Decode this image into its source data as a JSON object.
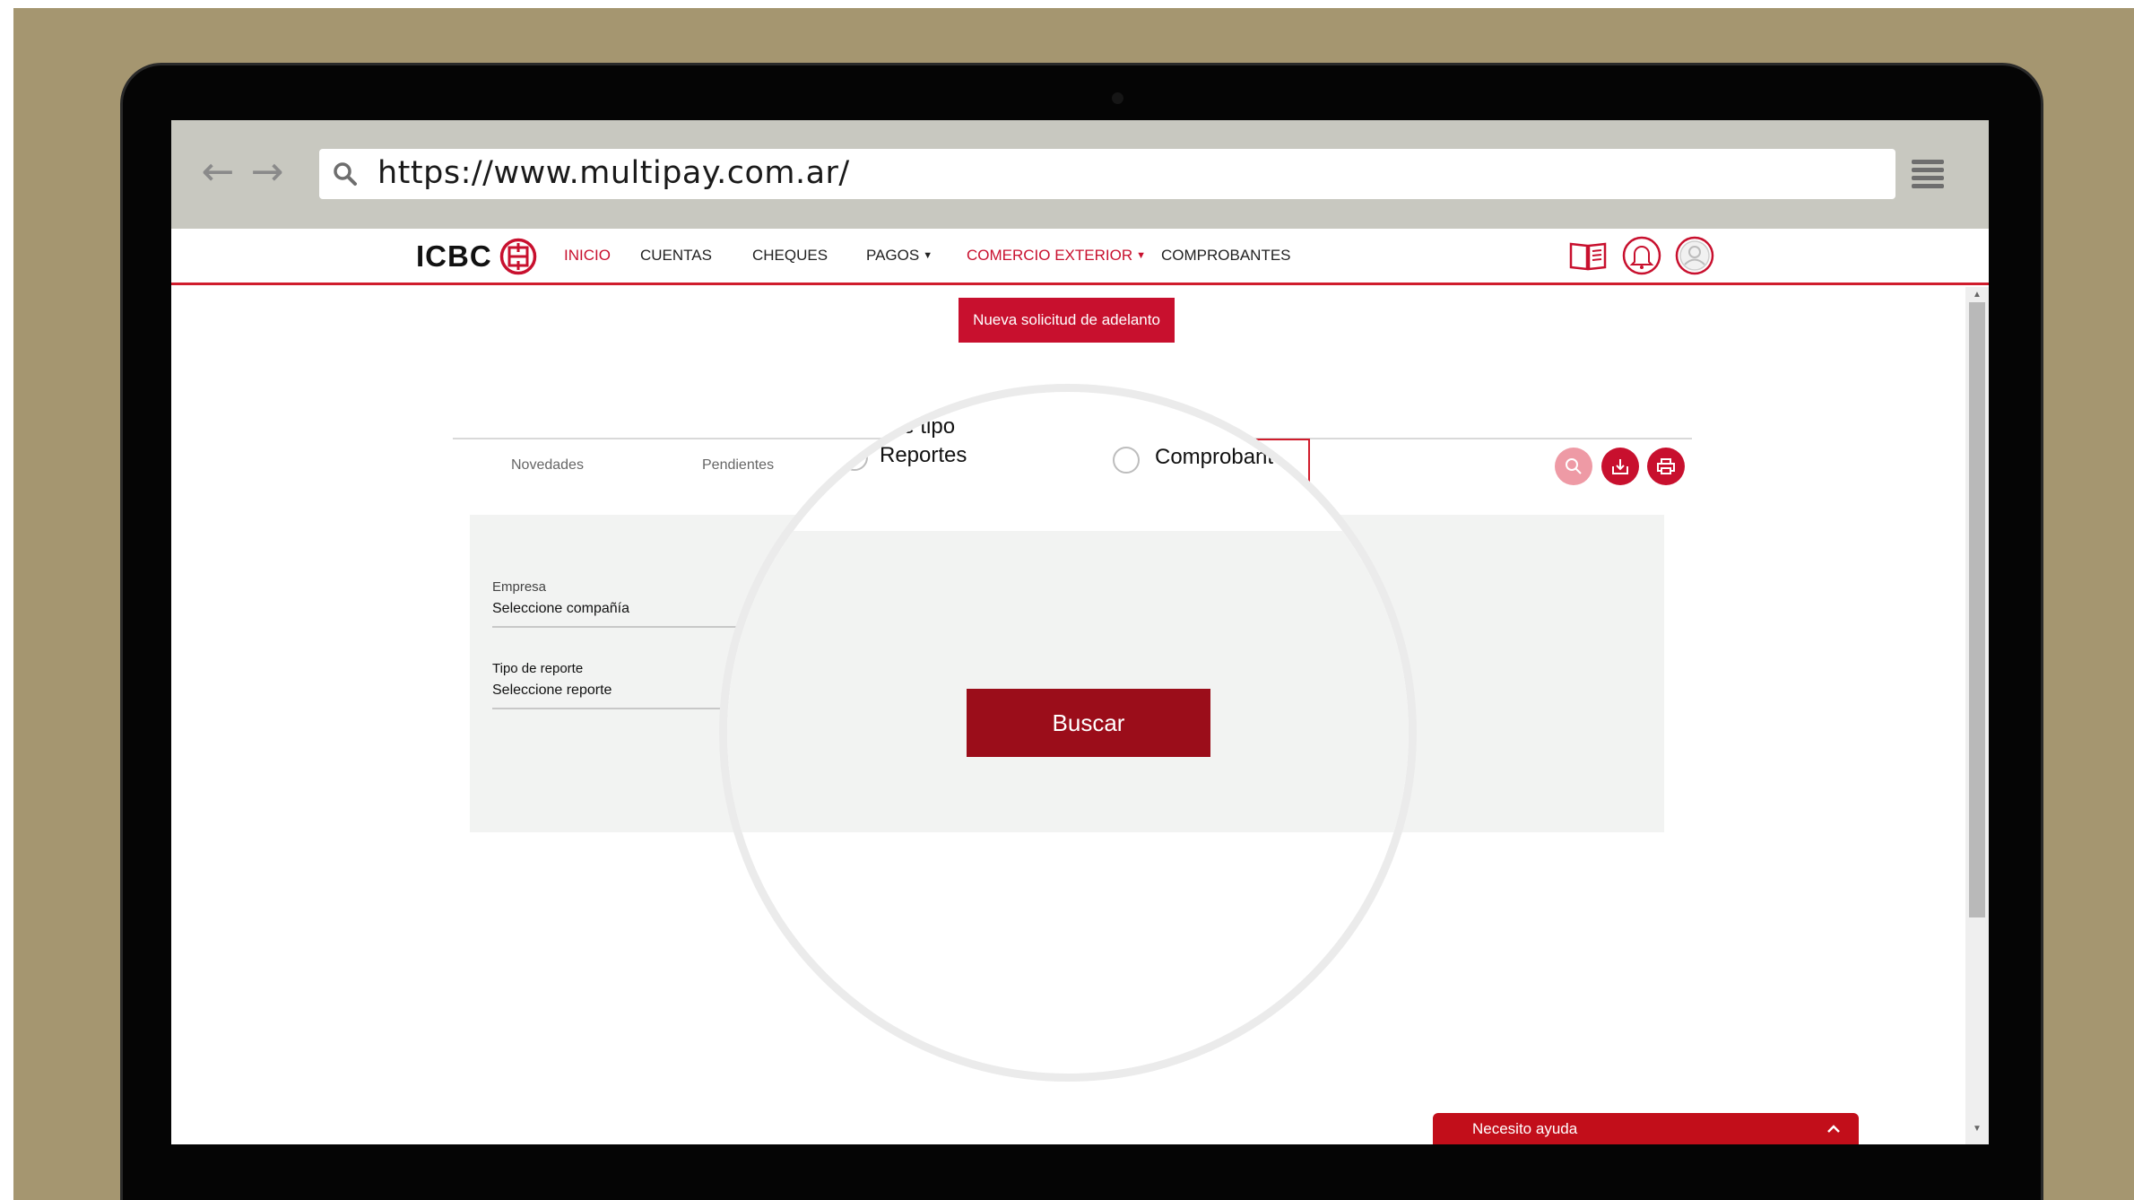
{
  "browser": {
    "url": "https://www.multipay.com.ar/",
    "back_icon": "arrow-left-icon",
    "forward_icon": "arrow-right-icon",
    "search_icon": "search-icon",
    "menu_icon": "hamburger-menu-icon"
  },
  "header": {
    "logo_text": "ICBC",
    "nav": [
      {
        "label": "INICIO",
        "active": true
      },
      {
        "label": "CUENTAS"
      },
      {
        "label": "CHEQUES"
      },
      {
        "label": "PAGOS",
        "dropdown": true
      },
      {
        "label": "COMERCIO EXTERIOR",
        "dropdown": true,
        "active": true
      },
      {
        "label": "COMPROBANTES"
      }
    ],
    "icons": [
      "book-icon",
      "bell-icon",
      "user-avatar-icon"
    ]
  },
  "content": {
    "primary_button": "Nueva solicitud de adelanto",
    "tabs": [
      "Novedades",
      "Pendientes"
    ],
    "actions": [
      "search-icon",
      "download-icon",
      "print-icon"
    ],
    "form": {
      "empresa_label": "Empresa",
      "empresa_value": "Seleccione compañía",
      "tipo_label": "Tipo de reporte",
      "tipo_value": "Seleccione reporte"
    }
  },
  "magnifier": {
    "heading_fragment": "ne tipo",
    "radio_reportes": "Reportes",
    "radio_comprobantes": "Comprobantes",
    "selected": "Reportes",
    "search_button": "Buscar"
  },
  "help": {
    "label": "Necesito ayuda"
  },
  "colors": {
    "brand_red": "#c8102e",
    "dark_red": "#9b0d1a",
    "radio_blue": "#49a9d6",
    "backdrop": "#a59670"
  }
}
